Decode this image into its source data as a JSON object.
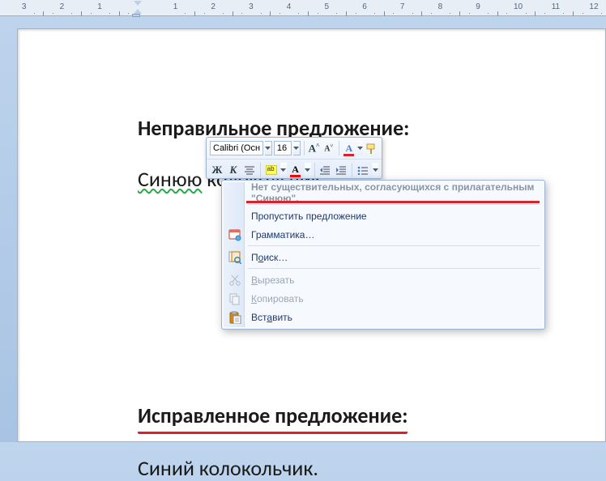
{
  "ruler": {
    "labels": [
      "3",
      "2",
      "1",
      "1",
      "2",
      "3",
      "4",
      "5",
      "6",
      "7",
      "8",
      "9",
      "10",
      "11",
      "12"
    ]
  },
  "document": {
    "heading1": "Неправильное предложение:",
    "sentence_word1": "Синюю",
    "sentence_word2": "колокольчик.",
    "heading2": "Исправленное предложение:",
    "sentence2": "Синий колокольчик."
  },
  "mini_toolbar": {
    "font_name": "Calibri (Осн",
    "font_size": "16",
    "btn_bold": "Ж",
    "btn_italic": "К",
    "btn_align": "≡",
    "btn_highlight": "ab",
    "btn_font_color": "A",
    "btn_grow": "A",
    "btn_shrink": "A",
    "btn_styles": "A",
    "btn_format_painter": "✎"
  },
  "context_menu": {
    "header": "Нет существительных, согласующихся с прилагательным \"Синюю\".",
    "items": [
      {
        "label": "Пропустить предложение",
        "icon": null,
        "enabled": true
      },
      {
        "label": "Грамматика…",
        "icon": "book",
        "enabled": true
      }
    ],
    "items2": [
      {
        "label": "Поиск…",
        "icon": "search",
        "enabled": true,
        "uindex": 1
      }
    ],
    "items3": [
      {
        "label": "Вырезать",
        "icon": "cut",
        "enabled": false,
        "uindex": 0
      },
      {
        "label": "Копировать",
        "icon": "copy",
        "enabled": false,
        "uindex": 0
      },
      {
        "label": "Вставить",
        "icon": "paste",
        "enabled": true,
        "uindex": 3
      }
    ]
  }
}
